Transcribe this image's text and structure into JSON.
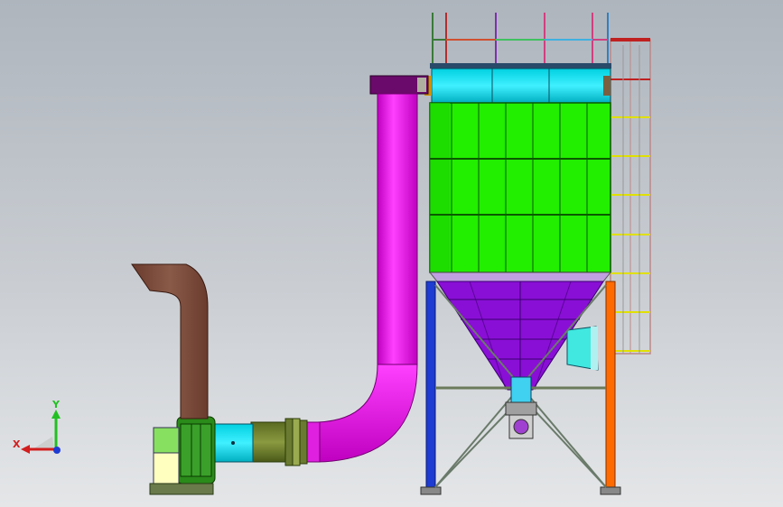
{
  "viewport": {
    "background_top": "#aeb5bd",
    "background_bottom": "#e4e6e8"
  },
  "triad": {
    "x_label": "X",
    "y_label": "Y",
    "x_color": "#d21e1e",
    "y_color": "#22c022",
    "z_color": "#1e3cd2"
  },
  "model": {
    "filter_color": "#22ee00",
    "top_box_color": "#00e5ff",
    "hopper_color": "#8a0fd6",
    "duct_color": "#ff00ff",
    "stack_color": "#7a4a3a",
    "left_leg_color": "#1e3cd2",
    "right_leg_color": "#ff6a00"
  }
}
